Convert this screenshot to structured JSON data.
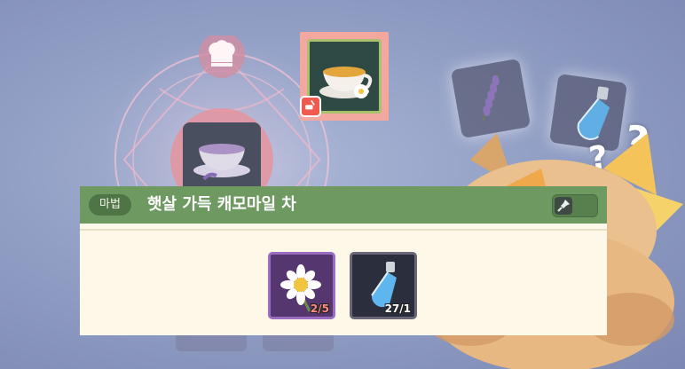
{
  "recipe": {
    "category_tag": "마법",
    "title": "햇살 가득 캐모마일 차",
    "result_item": "chamomile-tea-icon",
    "badge_icon": "cooking-pot-icon"
  },
  "ingredients": [
    {
      "name_icon": "chamomile-flower-icon",
      "have": "2",
      "need": "5",
      "count_text": "2/5",
      "sufficient": false
    },
    {
      "name_icon": "blue-potion-icon",
      "have": "27",
      "need": "1",
      "count_text": "27/1",
      "sufficient": true
    }
  ],
  "pin": {
    "icon": "pin-icon",
    "state": "off"
  },
  "background": {
    "magic_circle_icon": "chef-hat-icon",
    "floating_items": [
      "lavender-icon",
      "blue-potion-icon"
    ],
    "question_marks": [
      "?",
      "?"
    ]
  },
  "colors": {
    "header_green": "#6e9a62",
    "panel_cream": "#fdf8e7",
    "rare_purple": "#9a6dc1",
    "insufficient_red": "#ff8b82",
    "selected_highlight": "#f2a89e"
  }
}
